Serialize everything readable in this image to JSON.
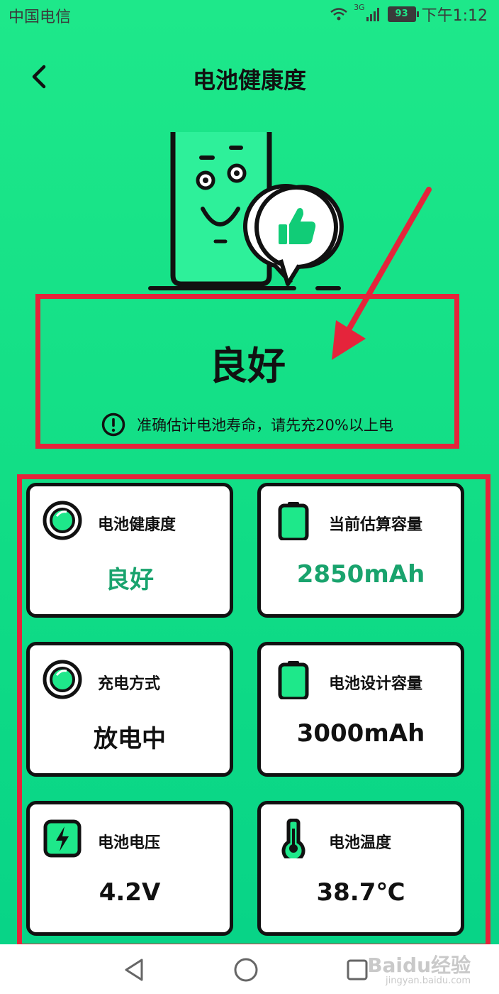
{
  "statusbar": {
    "carrier": "中国电信",
    "network": "3G",
    "battery": "93",
    "time": "下午1:12"
  },
  "header": {
    "title": "电池健康度"
  },
  "status": {
    "value": "良好",
    "notice": "准确估计电池寿命，请先充20%以上电"
  },
  "cards": [
    {
      "label": "电池健康度",
      "value": "良好",
      "icon": "circle-indicator-icon",
      "accent": true
    },
    {
      "label": "当前估算容量",
      "value": "2850mAh",
      "icon": "battery-icon",
      "accent": true
    },
    {
      "label": "充电方式",
      "value": "放电中",
      "icon": "circle-indicator-icon",
      "accent": false
    },
    {
      "label": "电池设计容量",
      "value": "3000mAh",
      "icon": "battery-icon",
      "accent": false
    },
    {
      "label": "电池电压",
      "value": "4.2V",
      "icon": "lightning-icon",
      "accent": false
    },
    {
      "label": "电池温度",
      "value": "38.7℃",
      "icon": "thermometer-icon",
      "accent": false
    }
  ],
  "watermark": {
    "brand": "Baidu经验",
    "url": "jingyan.baidu.com"
  },
  "colors": {
    "background": "#1ee88a",
    "accent_text": "#19a36d",
    "highlight_border": "#e5243b"
  }
}
